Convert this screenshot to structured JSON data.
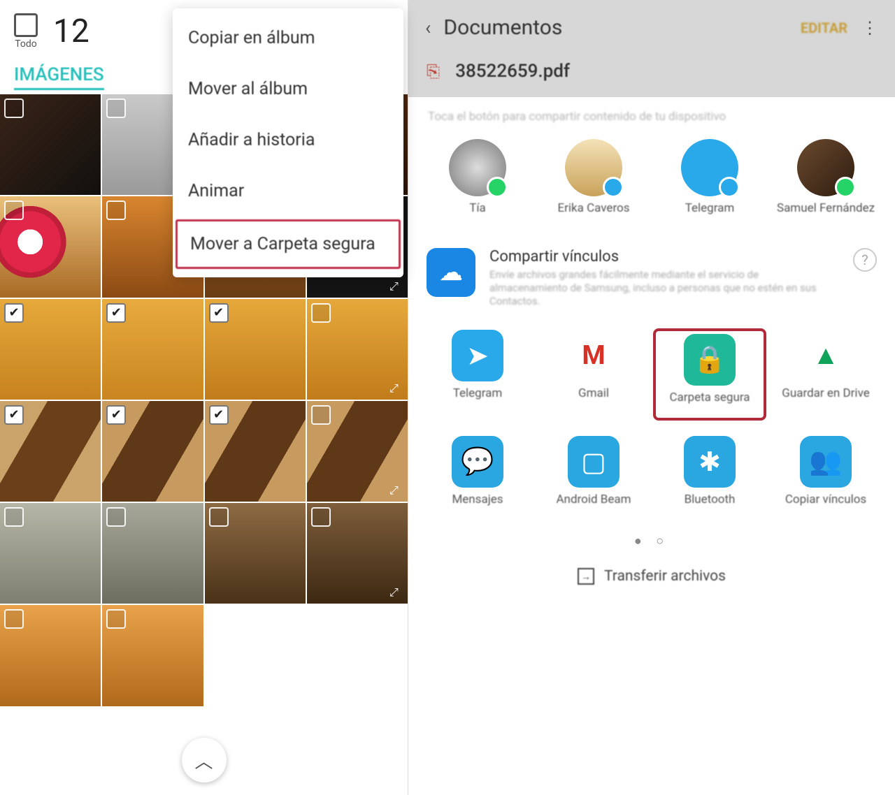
{
  "left": {
    "select_all_label": "Todo",
    "selected_count": "12",
    "tab_label": "IMÁGENES",
    "menu": {
      "copy": "Copiar en álbum",
      "move": "Mover al álbum",
      "story": "Añadir a historia",
      "animate": "Animar",
      "secure": "Mover a Carpeta segura"
    },
    "thumb_count": 22,
    "checked_indices": [
      8,
      9,
      10,
      12,
      13,
      14
    ]
  },
  "right": {
    "title": "Documentos",
    "edit_label": "EDITAR",
    "file_name": "38522659.pdf",
    "hint": "Toca el botón para compartir contenido de tu dispositivo",
    "contacts": [
      {
        "name": "Tía",
        "badge": "wa"
      },
      {
        "name": "Erika Caveros",
        "badge": "tg"
      },
      {
        "name": "Telegram",
        "badge": "tg"
      },
      {
        "name": "Samuel Fernández",
        "badge": "wa"
      }
    ],
    "link_share": {
      "title": "Compartir vínculos",
      "desc": "Envíe archivos grandes fácilmente mediante el servicio de almacenamiento de Samsung, incluso a personas que no estén en sus Contactos."
    },
    "apps_row1": [
      {
        "name": "Telegram",
        "color": "#29a9ea",
        "glyph": "➤"
      },
      {
        "name": "Gmail",
        "color": "#ffffff",
        "glyph": "M"
      },
      {
        "name": "Carpeta segura",
        "color": "#1fb99a",
        "glyph": "🔒",
        "highlight": true
      },
      {
        "name": "Guardar en Drive",
        "color": "#ffffff",
        "glyph": "▲"
      }
    ],
    "apps_row2": [
      {
        "name": "Mensajes",
        "color": "#2aa7e0",
        "glyph": "💬"
      },
      {
        "name": "Android Beam",
        "color": "#2aa7e0",
        "glyph": "▢"
      },
      {
        "name": "Bluetooth",
        "color": "#2aa7e0",
        "glyph": "✱"
      },
      {
        "name": "Copiar vínculos",
        "color": "#2aa7e0",
        "glyph": "👥"
      }
    ],
    "transfer_label": "Transferir archivos"
  }
}
